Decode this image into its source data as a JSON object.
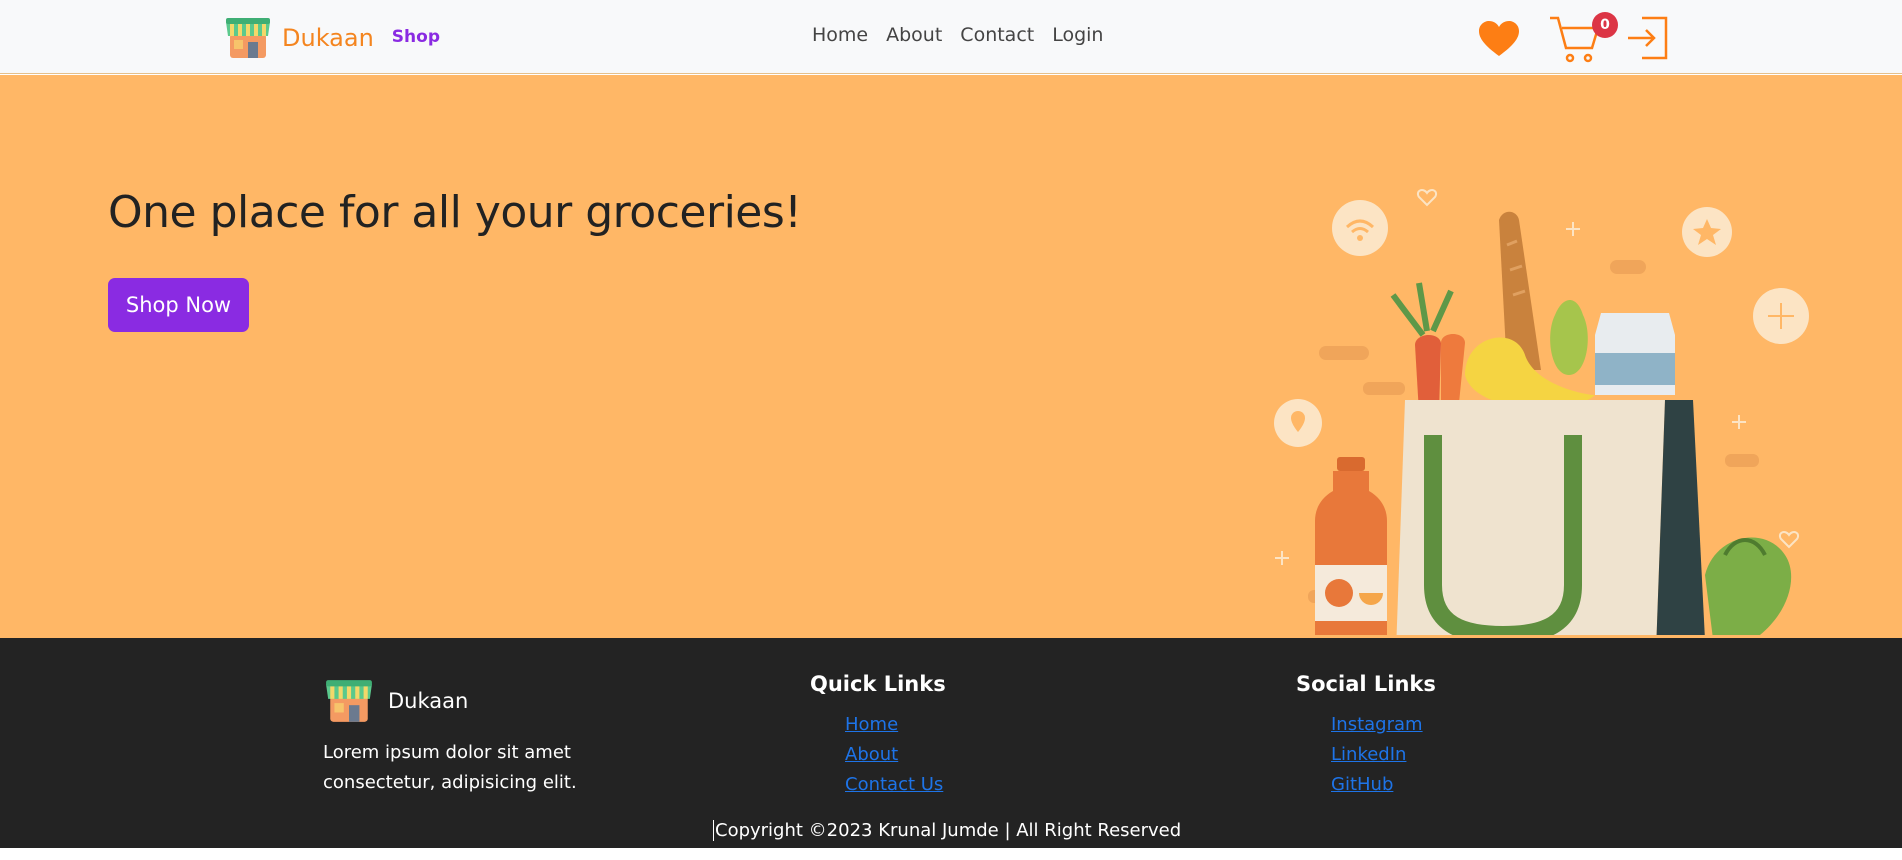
{
  "navbar": {
    "brand_name": "Dukaan",
    "brand_tag": "Shop",
    "links": [
      "Home",
      "About",
      "Contact",
      "Login"
    ],
    "cart_count": "0",
    "icons": [
      "shop-logo-icon",
      "heart-icon",
      "cart-icon",
      "login-icon"
    ]
  },
  "hero": {
    "title": "One place for all your groceries!",
    "button_label": "Shop Now"
  },
  "footer": {
    "brand_name": "Dukaan",
    "description": "Lorem ipsum dolor sit amet consectetur, adipisicing elit.",
    "quick_links_title": "Quick Links",
    "quick_links": [
      "Home",
      "About",
      "Contact Us"
    ],
    "social_links_title": "Social Links",
    "social_links": [
      "Instagram",
      "LinkedIn",
      "GitHub"
    ],
    "copyright": "Copyright ©2023 Krunal Jumde | All Right Reserved"
  },
  "colors": {
    "brand_orange": "#f4851f",
    "accent_purple": "#8a2be2",
    "hero_bg": "#ffb766",
    "footer_bg": "#232323",
    "link_blue": "#1e74e8",
    "badge_red": "#dc3545"
  }
}
